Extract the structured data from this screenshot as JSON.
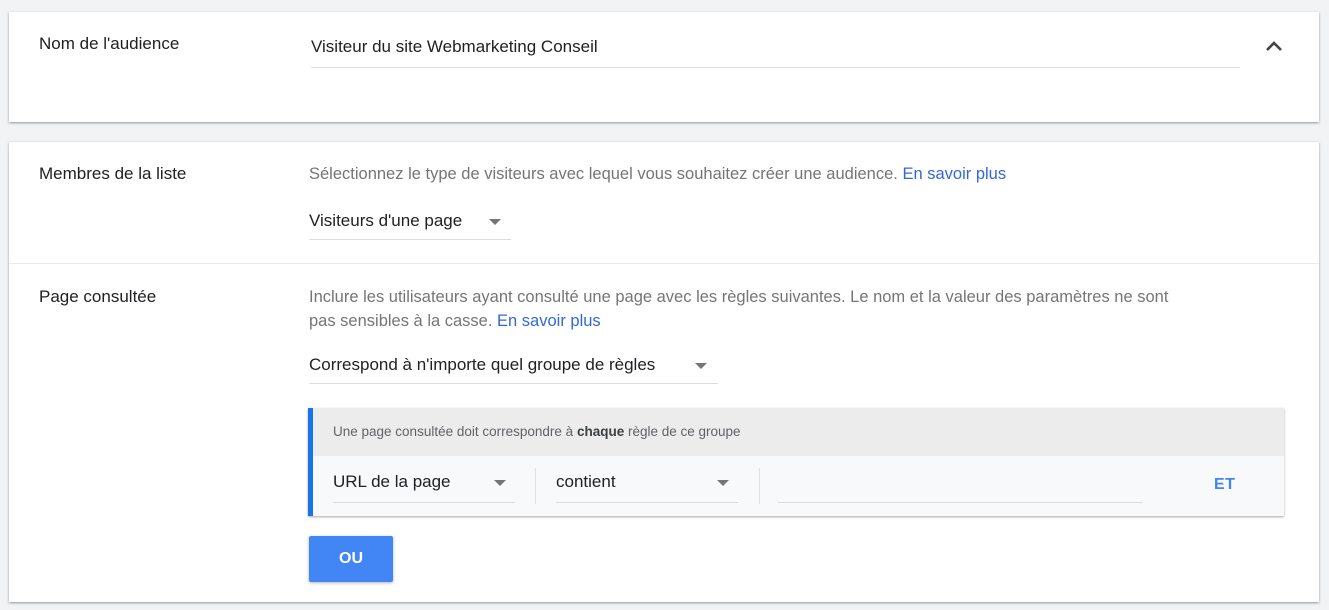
{
  "audience_name": {
    "label": "Nom de l'audience",
    "value": "Visiteur du site Webmarketing Conseil",
    "collapse_icon": "chevron-up-icon"
  },
  "list_members": {
    "label": "Membres de la liste",
    "description": "Sélectionnez le type de visiteurs avec lequel vous souhaitez créer une audience.",
    "link": "En savoir plus",
    "selected": "Visiteurs d'une page"
  },
  "page_visited": {
    "label": "Page consultée",
    "description_line1": "Inclure les utilisateurs ayant consulté une page avec les règles suivantes. Le nom et la valeur des paramètres ne sont",
    "description_line2": "pas sensibles à la casse.",
    "link": "En savoir plus",
    "match_selected": "Correspond à n'importe quel groupe de règles"
  },
  "rule_group": {
    "header_prefix": "Une page consultée doit correspondre à",
    "header_bold": "chaque",
    "header_suffix": "règle de ce groupe",
    "field": "URL de la page",
    "operator": "contient",
    "value": "",
    "and_button": "ET"
  },
  "or_button": "OU",
  "colors": {
    "accent": "#1a73e8",
    "button": "#4285f4",
    "link": "#3367d6"
  }
}
